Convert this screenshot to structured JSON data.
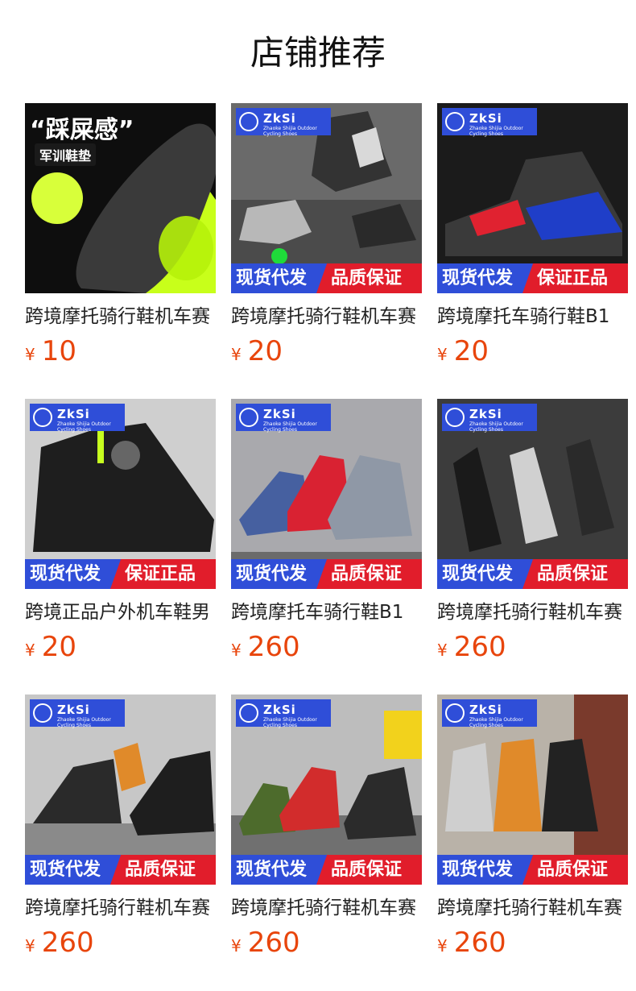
{
  "header": {
    "title": "店铺推荐"
  },
  "colors": {
    "price": "#e8450c",
    "band_left": "#2f4ed8",
    "band_right": "#e11d2b"
  },
  "brand": {
    "logo_text": "ZkSi",
    "logo_sub": "Zhaoke Shijia Outdoor Cycling Shoes"
  },
  "products": [
    {
      "name": "跨境摩托骑行鞋机车赛",
      "currency": "¥",
      "price": "10",
      "band_left": "",
      "band_right": "",
      "insole_headline": "“踩屎感”",
      "insole_tag": "军训鞋垫"
    },
    {
      "name": "跨境摩托骑行鞋机车赛",
      "currency": "¥",
      "price": "20",
      "band_left": "现货代发",
      "band_right": "品质保证"
    },
    {
      "name": "跨境摩托车骑行鞋B1",
      "currency": "¥",
      "price": "20",
      "band_left": "现货代发",
      "band_right": "保证正品"
    },
    {
      "name": "跨境正品户外机车鞋男",
      "currency": "¥",
      "price": "20",
      "band_left": "现货代发",
      "band_right": "保证正品"
    },
    {
      "name": "跨境摩托车骑行鞋B1",
      "currency": "¥",
      "price": "260",
      "band_left": "现货代发",
      "band_right": "品质保证"
    },
    {
      "name": "跨境摩托骑行鞋机车赛",
      "currency": "¥",
      "price": "260",
      "band_left": "现货代发",
      "band_right": "品质保证"
    },
    {
      "name": "跨境摩托骑行鞋机车赛",
      "currency": "¥",
      "price": "260",
      "band_left": "现货代发",
      "band_right": "品质保证"
    },
    {
      "name": "跨境摩托骑行鞋机车赛",
      "currency": "¥",
      "price": "260",
      "band_left": "现货代发",
      "band_right": "品质保证"
    },
    {
      "name": "跨境摩托骑行鞋机车赛",
      "currency": "¥",
      "price": "260",
      "band_left": "现货代发",
      "band_right": "品质保证"
    }
  ]
}
